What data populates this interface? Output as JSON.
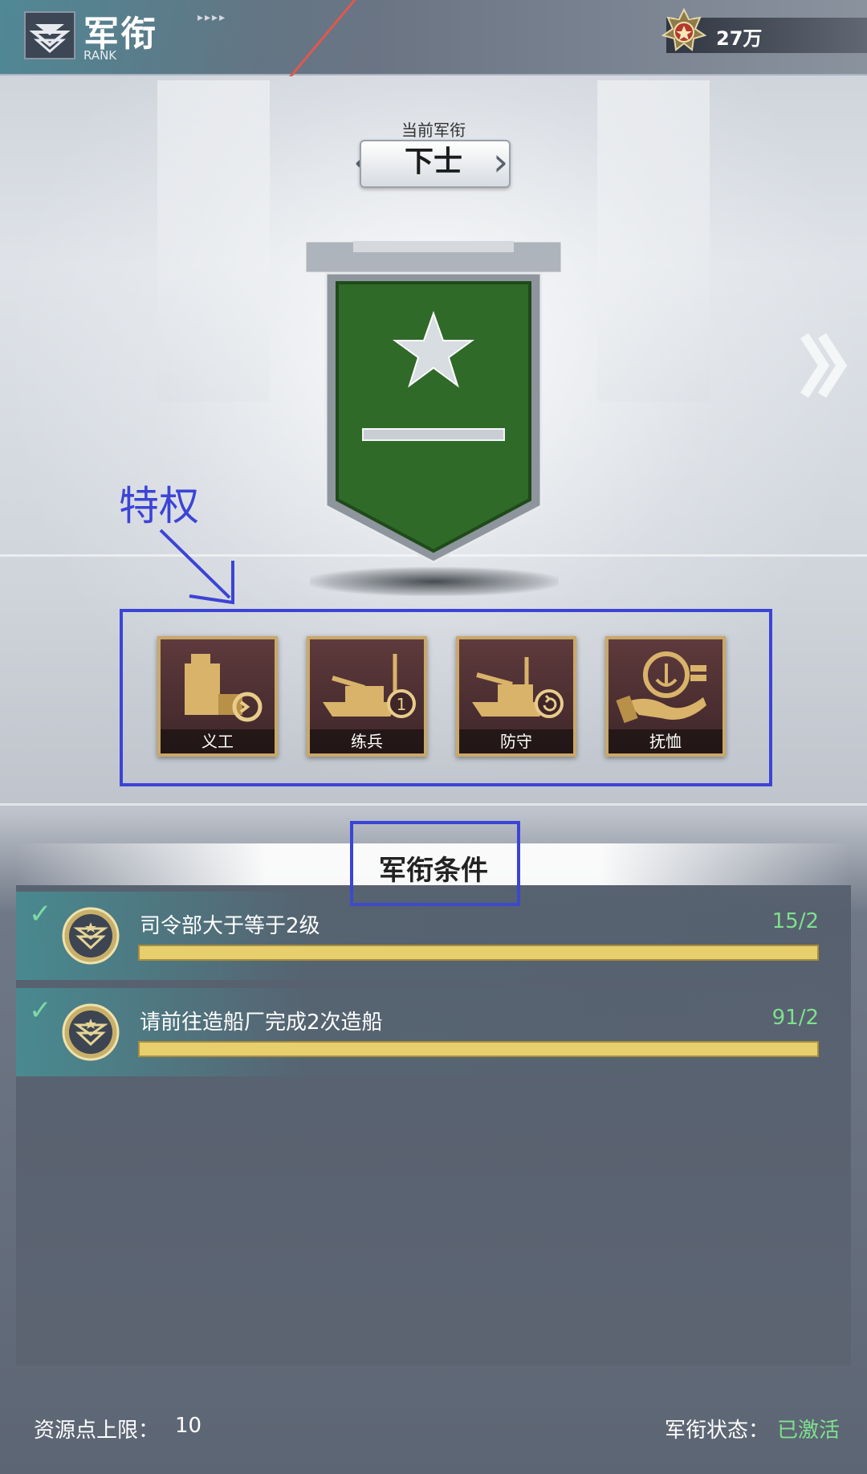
{
  "header": {
    "title": "军衔",
    "subtitle": "RANK",
    "resource_value": "27万"
  },
  "rank": {
    "current_label": "当前军衔",
    "current_name": "下士"
  },
  "annotations": {
    "privilege_label": "特权"
  },
  "privileges": [
    {
      "label": "义工",
      "icon": "crane-repair-icon"
    },
    {
      "label": "练兵",
      "icon": "warship-training-icon"
    },
    {
      "label": "防守",
      "icon": "warship-defense-icon"
    },
    {
      "label": "抚恤",
      "icon": "hand-anchor-coin-icon"
    }
  ],
  "conditions": {
    "title": "军衔条件",
    "items": [
      {
        "text": "司令部大于等于2级",
        "count": "15/2",
        "progress": 1.0,
        "completed": true
      },
      {
        "text": "请前往造船厂完成2次造船",
        "count": "91/2",
        "progress": 1.0,
        "completed": true
      }
    ]
  },
  "footer": {
    "resource_cap_label": "资源点上限：",
    "resource_cap_value": "10",
    "status_label": "军衔状态：",
    "status_value": "已激活"
  },
  "colors": {
    "annotation_blue": "#3b44d6",
    "count_green": "#7fe08e",
    "progress_gold": "#e8cf6e",
    "badge_green": "#2f6a28"
  }
}
